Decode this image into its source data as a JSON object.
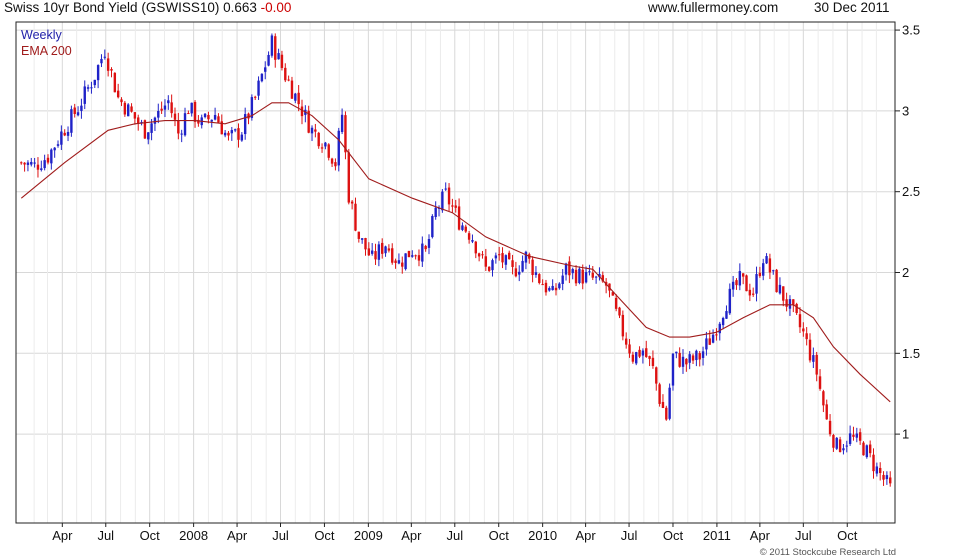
{
  "header": {
    "title": "Swiss 10yr Bond Yield (GSWISS10) 0.663",
    "change": "-0.00",
    "site": "www.fullermoney.com",
    "date": "30 Dec 2011"
  },
  "footer": {
    "copyright": "© 2011 Stockcube Research Ltd"
  },
  "colors": {
    "up": "#1f22c8",
    "down": "#dd1111",
    "ema": "#a01c1c",
    "grid": "#d8d8d8",
    "change": "#cc0000"
  },
  "chart_data": {
    "type": "candlestick",
    "legend": [
      {
        "label": "Weekly",
        "color": "#2222aa"
      },
      {
        "label": "EMA 200",
        "color": "#a01c1c"
      }
    ],
    "ylim": [
      0.45,
      3.55
    ],
    "y_ticks": [
      "3.5",
      "3",
      "2.5",
      "2",
      "1.5",
      "1"
    ],
    "x_tick_labels": [
      "Apr",
      "Jul",
      "Oct",
      "2008",
      "Apr",
      "Jul",
      "Oct",
      "2009",
      "Apr",
      "Jul",
      "Oct",
      "2010",
      "Apr",
      "Jul",
      "Oct",
      "2011",
      "Apr",
      "Jul",
      "Oct"
    ],
    "close_path": [
      [
        "2007-01-05",
        2.68
      ],
      [
        "2007-02-02",
        2.66
      ],
      [
        "2007-03-02",
        2.72
      ],
      [
        "2007-03-30",
        2.86
      ],
      [
        "2007-05-04",
        3.02
      ],
      [
        "2007-06-08",
        3.22
      ],
      [
        "2007-06-29",
        3.38
      ],
      [
        "2007-07-27",
        3.08
      ],
      [
        "2007-08-24",
        2.98
      ],
      [
        "2007-09-21",
        2.88
      ],
      [
        "2007-10-19",
        2.98
      ],
      [
        "2007-11-09",
        3.06
      ],
      [
        "2007-11-30",
        2.86
      ],
      [
        "2007-12-21",
        3.02
      ],
      [
        "2008-01-18",
        2.92
      ],
      [
        "2008-02-15",
        2.98
      ],
      [
        "2008-03-14",
        2.82
      ],
      [
        "2008-04-11",
        2.88
      ],
      [
        "2008-05-09",
        3.08
      ],
      [
        "2008-06-13",
        3.42
      ],
      [
        "2008-07-11",
        3.22
      ],
      [
        "2008-08-08",
        3.05
      ],
      [
        "2008-09-05",
        2.88
      ],
      [
        "2008-10-03",
        2.8
      ],
      [
        "2008-10-24",
        2.68
      ],
      [
        "2008-11-07",
        2.98
      ],
      [
        "2008-11-21",
        2.48
      ],
      [
        "2008-12-12",
        2.22
      ],
      [
        "2009-01-09",
        2.08
      ],
      [
        "2009-02-06",
        2.18
      ],
      [
        "2009-03-06",
        2.06
      ],
      [
        "2009-04-03",
        2.14
      ],
      [
        "2009-05-01",
        2.12
      ],
      [
        "2009-05-22",
        2.38
      ],
      [
        "2009-06-12",
        2.48
      ],
      [
        "2009-07-10",
        2.32
      ],
      [
        "2009-08-07",
        2.22
      ],
      [
        "2009-09-04",
        2.02
      ],
      [
        "2009-10-02",
        2.1
      ],
      [
        "2009-10-30",
        2.0
      ],
      [
        "2009-11-27",
        2.1
      ],
      [
        "2009-12-25",
        1.96
      ],
      [
        "2010-01-22",
        1.86
      ],
      [
        "2010-02-19",
        2.02
      ],
      [
        "2010-03-19",
        1.98
      ],
      [
        "2010-04-16",
        1.96
      ],
      [
        "2010-05-14",
        1.92
      ],
      [
        "2010-06-11",
        1.68
      ],
      [
        "2010-07-09",
        1.48
      ],
      [
        "2010-07-30",
        1.52
      ],
      [
        "2010-08-20",
        1.4
      ],
      [
        "2010-09-03",
        1.22
      ],
      [
        "2010-09-17",
        1.1
      ],
      [
        "2010-10-01",
        1.48
      ],
      [
        "2010-10-29",
        1.44
      ],
      [
        "2010-11-26",
        1.48
      ],
      [
        "2010-12-24",
        1.62
      ],
      [
        "2011-01-21",
        1.82
      ],
      [
        "2011-02-18",
        1.95
      ],
      [
        "2011-03-18",
        1.88
      ],
      [
        "2011-04-08",
        2.1
      ],
      [
        "2011-05-06",
        1.92
      ],
      [
        "2011-06-03",
        1.78
      ],
      [
        "2011-07-01",
        1.62
      ],
      [
        "2011-07-29",
        1.38
      ],
      [
        "2011-08-19",
        1.08
      ],
      [
        "2011-09-09",
        0.92
      ],
      [
        "2011-10-07",
        0.98
      ],
      [
        "2011-11-04",
        0.92
      ],
      [
        "2011-12-02",
        0.78
      ],
      [
        "2011-12-30",
        0.66
      ]
    ],
    "ema_path": [
      [
        "2007-01-05",
        2.46
      ],
      [
        "2007-04-06",
        2.68
      ],
      [
        "2007-07-06",
        2.88
      ],
      [
        "2007-08-31",
        2.92
      ],
      [
        "2007-11-02",
        2.94
      ],
      [
        "2008-01-04",
        2.94
      ],
      [
        "2008-03-07",
        2.92
      ],
      [
        "2008-05-02",
        2.97
      ],
      [
        "2008-06-13",
        3.05
      ],
      [
        "2008-07-18",
        3.05
      ],
      [
        "2008-09-05",
        2.97
      ],
      [
        "2008-10-31",
        2.82
      ],
      [
        "2009-01-02",
        2.58
      ],
      [
        "2009-04-03",
        2.46
      ],
      [
        "2009-06-26",
        2.37
      ],
      [
        "2009-09-04",
        2.22
      ],
      [
        "2009-12-04",
        2.1
      ],
      [
        "2010-03-05",
        2.04
      ],
      [
        "2010-04-16",
        2.02
      ],
      [
        "2010-06-04",
        1.86
      ],
      [
        "2010-08-06",
        1.66
      ],
      [
        "2010-09-24",
        1.6
      ],
      [
        "2010-11-05",
        1.6
      ],
      [
        "2010-12-31",
        1.63
      ],
      [
        "2011-02-25",
        1.72
      ],
      [
        "2011-04-22",
        1.8
      ],
      [
        "2011-06-10",
        1.8
      ],
      [
        "2011-07-22",
        1.72
      ],
      [
        "2011-09-02",
        1.54
      ],
      [
        "2011-10-28",
        1.37
      ],
      [
        "2011-12-30",
        1.2
      ]
    ]
  }
}
